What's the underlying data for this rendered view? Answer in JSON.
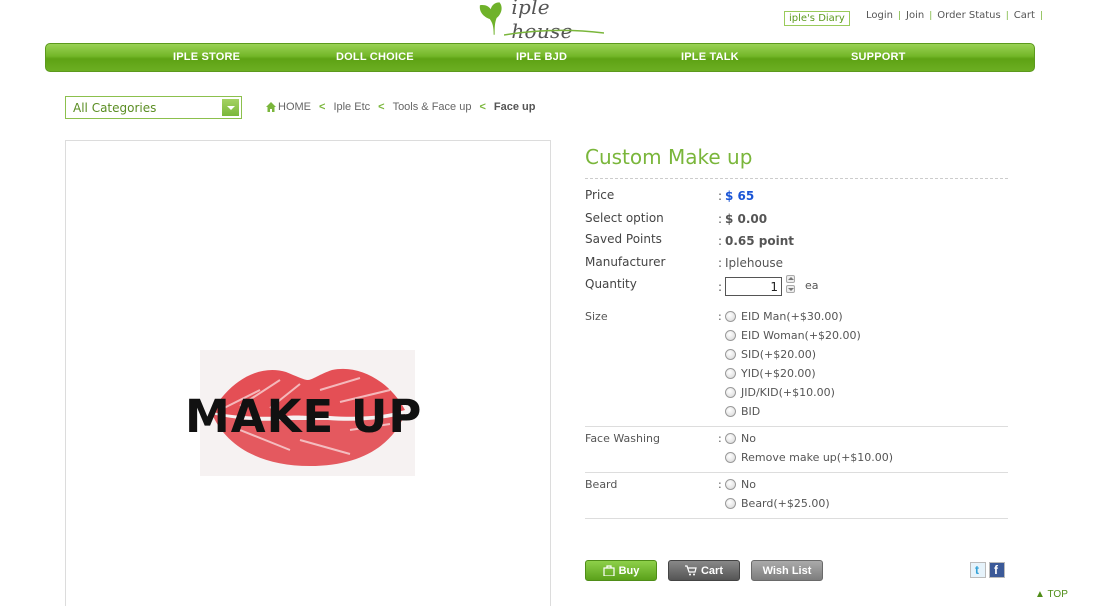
{
  "header": {
    "logo_text": "iple house",
    "diary_label": "iple's Diary",
    "links": [
      "Login",
      "Join",
      "Order Status",
      "Cart"
    ]
  },
  "nav": [
    "IPLE STORE",
    "DOLL CHOICE",
    "IPLE BJD",
    "IPLE TALK",
    "SUPPORT"
  ],
  "category_select": {
    "value": "All Categories"
  },
  "breadcrumb": {
    "home": "HOME",
    "items": [
      "Iple Etc",
      "Tools & Face up"
    ],
    "current": "Face up"
  },
  "product_image": {
    "text": "MAKE UP"
  },
  "product": {
    "title": "Custom Make up",
    "price_label": "Price",
    "price": "$ 65",
    "select_option_label": "Select option",
    "select_option": "$ 0.00",
    "saved_points_label": "Saved Points",
    "saved_points": "0.65 point",
    "manufacturer_label": "Manufacturer",
    "manufacturer": "Iplehouse",
    "quantity_label": "Quantity",
    "quantity": "1",
    "quantity_unit": "ea",
    "colon": ":"
  },
  "options": {
    "size": {
      "label": "Size",
      "choices": [
        "EID Man(+$30.00)",
        "EID Woman(+$20.00)",
        "SID(+$20.00)",
        "YID(+$20.00)",
        "JID/KID(+$10.00)",
        "BID"
      ]
    },
    "face_washing": {
      "label": "Face Washing",
      "choices": [
        "No",
        "Remove make up(+$10.00)"
      ]
    },
    "beard": {
      "label": "Beard",
      "choices": [
        "No",
        "Beard(+$25.00)"
      ]
    }
  },
  "buttons": {
    "buy": "Buy",
    "cart": "Cart",
    "wish": "Wish List"
  },
  "share": {
    "twitter": "t",
    "facebook": "f"
  },
  "top_link": "▲ TOP",
  "colors": {
    "brand_green": "#7ab63b",
    "price_blue": "#1a55d6"
  }
}
